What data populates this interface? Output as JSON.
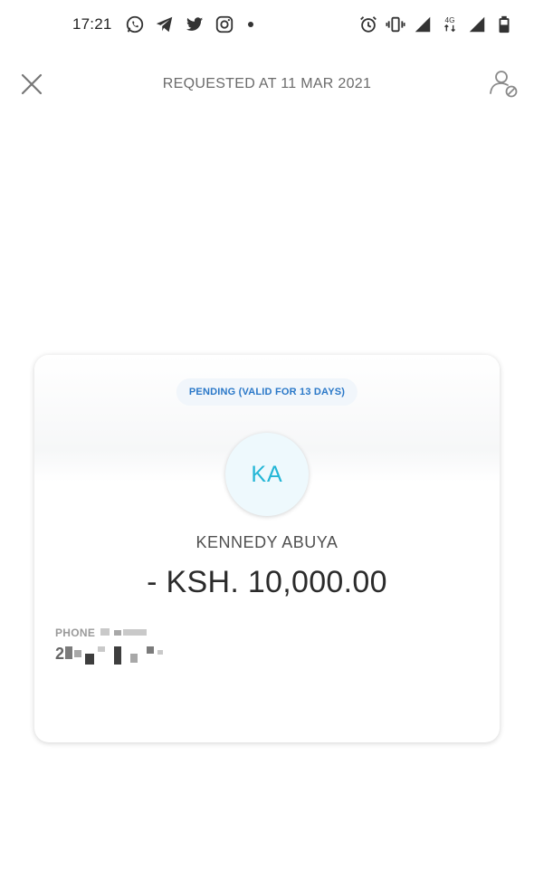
{
  "status_bar": {
    "time": "17:21",
    "left_icons": [
      "whatsapp-icon",
      "telegram-icon",
      "twitter-icon",
      "instagram-icon",
      "notification-dot-icon"
    ],
    "right_icons": [
      "alarm-icon",
      "vibrate-icon",
      "signal-icon",
      "network-4g-icon",
      "signal-icon",
      "battery-icon"
    ],
    "network_label": "4G"
  },
  "header": {
    "title": "REQUESTED AT 11 MAR 2021",
    "close_icon": "close-icon",
    "action_icon": "block-user-icon"
  },
  "card": {
    "status": "PENDING (VALID FOR 13 DAYS)",
    "avatar_initials": "KA",
    "name": "KENNEDY ABUYA",
    "amount": "- KSH. 10,000.00",
    "phone_label": "PHONE",
    "phone_value_visible": "2"
  },
  "colors": {
    "status_text": "#2a78c8",
    "avatar_text": "#23b6d6",
    "avatar_bg": "#eef9fd"
  }
}
